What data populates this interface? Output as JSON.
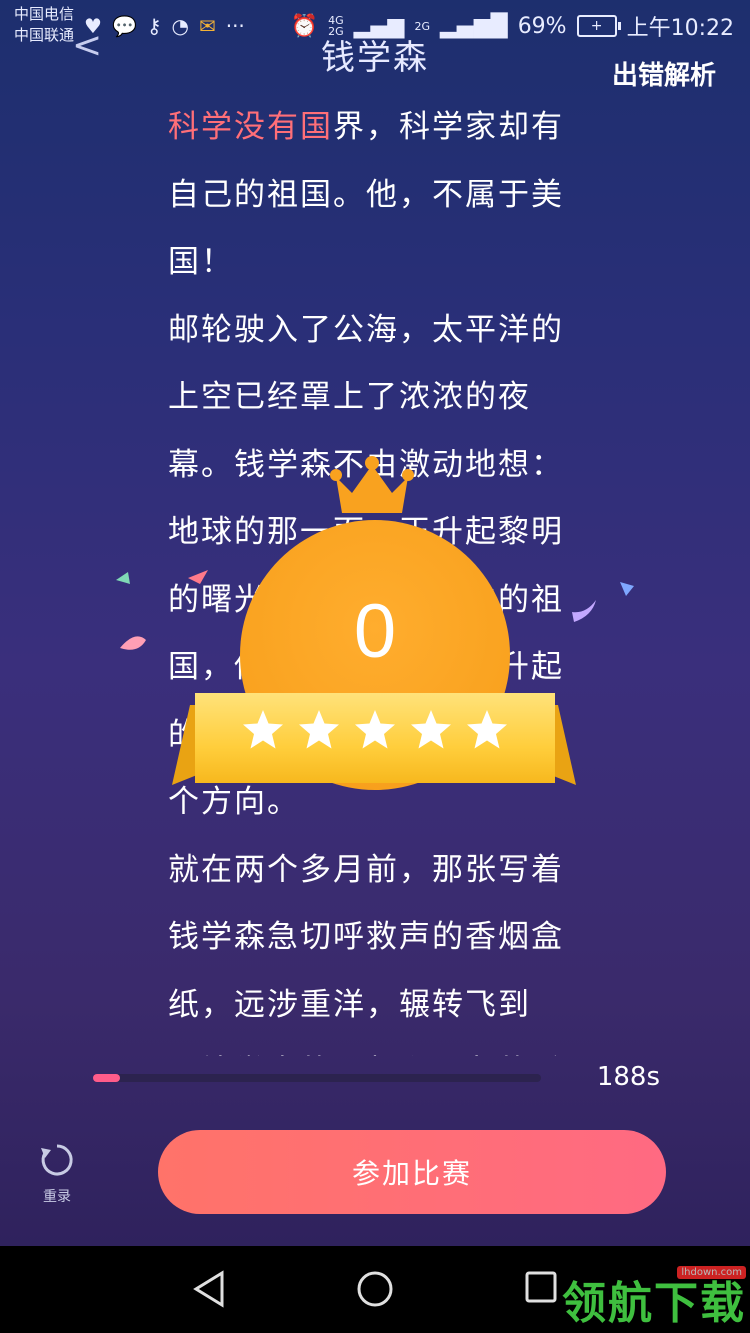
{
  "statusbar": {
    "carrier1": "中国电信",
    "carrier2": "中国联通",
    "net1": "4G",
    "net2": "2G",
    "net3": "2G",
    "battery": "69%",
    "time": "上午10:22"
  },
  "header": {
    "title": "钱学森",
    "error_analysis": "出错解析"
  },
  "article": {
    "highlight": "科学没有国",
    "p1_rest": "界，科学家却有自己的祖国。他，不属于美国！",
    "p2": "邮轮驶入了公海，太平洋的上空已经罩上了浓浓的夜幕。钱学森不由激动地想：地球的那一面，正升起黎明的曙光，在那里，是他的祖国，他的家，他的那里升起的朝阳，他的希望也来自那个方向。",
    "p3": "就在两个多月前，那张写着钱学森急切呼救声的香烟盒纸，远涉重洋，辗转飞到",
    "p4": "了钱学森的导师和朋友的手"
  },
  "result": {
    "score": "0",
    "stars_total": 5,
    "stars_filled": 0
  },
  "progress": {
    "fraction": 0.06,
    "time_left": "188s"
  },
  "actions": {
    "rerecord_label": "重录",
    "join_label": "参加比赛"
  },
  "watermark": {
    "site": "lhdown.com",
    "brand": "领航下载"
  },
  "colors": {
    "accent_pink": "#ff6f78",
    "badge_orange": "#f9a21f",
    "ribbon_yellow": "#ffce3c",
    "progress": "#ff5c8a"
  }
}
